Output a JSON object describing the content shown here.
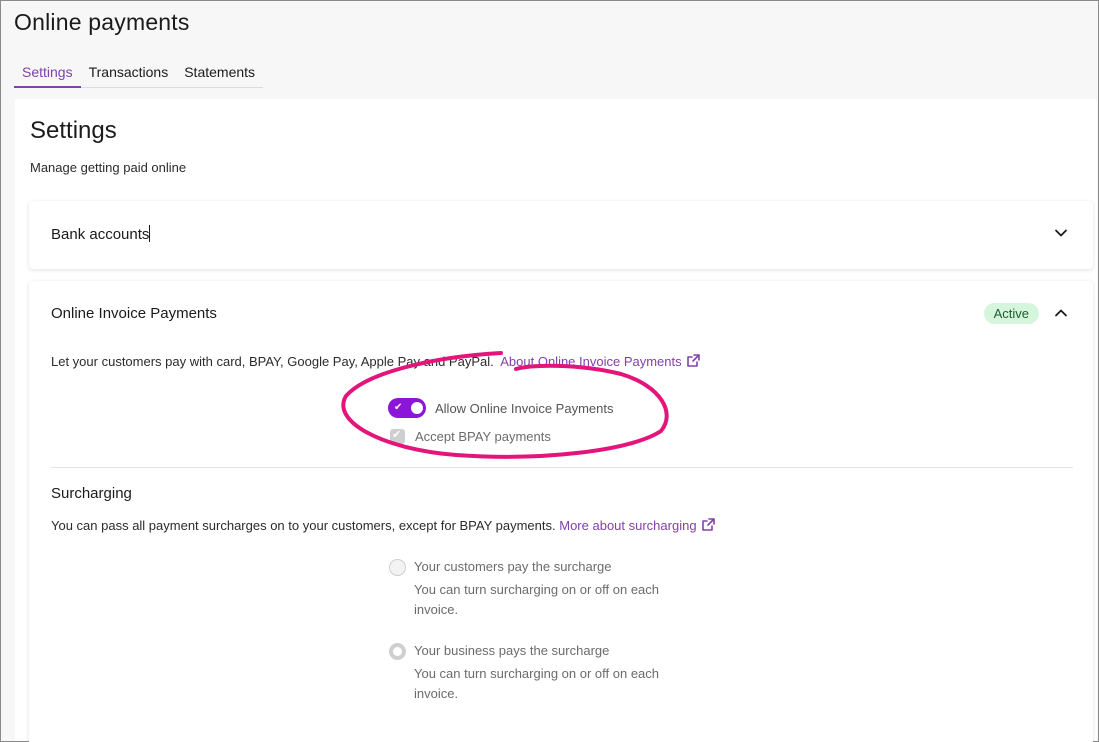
{
  "header": {
    "title": "Online payments",
    "tabs": [
      {
        "label": "Settings",
        "active": true
      },
      {
        "label": "Transactions",
        "active": false
      },
      {
        "label": "Statements",
        "active": false
      }
    ]
  },
  "settings": {
    "heading": "Settings",
    "subtitle": "Manage getting paid online"
  },
  "bank_accounts": {
    "title": "Bank accounts",
    "expanded": false
  },
  "online_invoice_payments": {
    "title": "Online Invoice Payments",
    "status_badge": "Active",
    "expanded": true,
    "description": "Let your customers pay with card, BPAY, Google Pay, Apple Pay and PayPal.",
    "about_link": "About Online Invoice Payments",
    "allow_toggle": {
      "label": "Allow Online Invoice Payments",
      "on": true
    },
    "bpay_checkbox": {
      "label": "Accept BPAY payments",
      "checked": true,
      "disabled": true
    }
  },
  "surcharging": {
    "title": "Surcharging",
    "description": "You can pass all payment surcharges on to your customers, except for BPAY payments.",
    "more_link": "More about surcharging",
    "options": [
      {
        "label": "Your customers pay the surcharge",
        "hint": "You can turn surcharging on or off on each invoice.",
        "selected": false
      },
      {
        "label": "Your business pays the surcharge",
        "hint": "You can turn surcharging on or off on each invoice.",
        "selected": true
      }
    ]
  },
  "colors": {
    "accent": "#8241aa",
    "toggle": "#8b16d9",
    "badge_bg": "#d5f5dd",
    "annotation": "#e3157a"
  },
  "icons": {
    "chevron_down": "chevron-down-icon",
    "chevron_up": "chevron-up-icon",
    "external_link": "external-link-icon"
  }
}
